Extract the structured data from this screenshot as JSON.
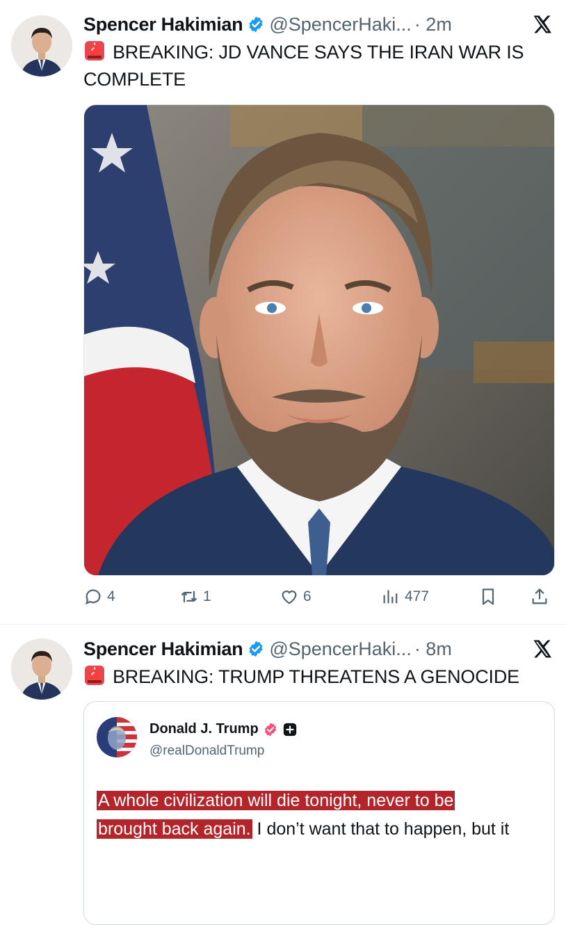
{
  "tweets": [
    {
      "author": "Spencer Hakimian",
      "handle": "@SpencerHaki...",
      "time": "· 2m",
      "text": "BREAKING: JD VANCE SAYS THE IRAN WAR IS COMPLETE",
      "actions": {
        "replies": "4",
        "retweets": "1",
        "likes": "6",
        "views": "477"
      }
    },
    {
      "author": "Spencer Hakimian",
      "handle": "@SpencerHaki...",
      "time": "· 8m",
      "text": "BREAKING: TRUMP THREATENS A GENOCIDE",
      "quote": {
        "author": "Donald J. Trump",
        "handle": "@realDonaldTrump",
        "highlight_1": "A whole civilization will die tonight, never to be",
        "highlight_2": "brought back again.",
        "rest": " I don’t want that to happen, but it"
      }
    }
  ],
  "colors": {
    "verified_blue": "#1d9bf0",
    "muted_text": "#536471",
    "highlight": "#b3252a",
    "trump_badge": "#f4517d"
  },
  "icons": [
    "x-logo-icon",
    "siren-icon",
    "verified-badge-icon",
    "reply-icon",
    "retweet-icon",
    "like-icon",
    "views-icon",
    "bookmark-icon",
    "share-icon",
    "plus-badge-icon"
  ]
}
